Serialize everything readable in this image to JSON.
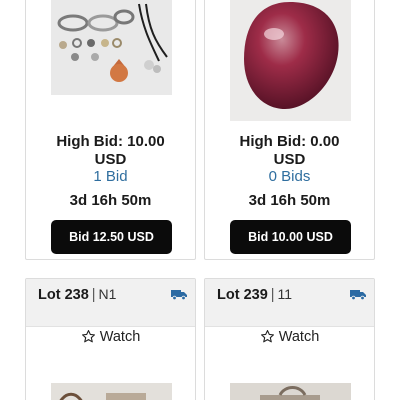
{
  "lots_top": [
    {
      "image_alt": "Jewelry lot with bracelets, rings and necklaces",
      "high_bid": "High Bid: 10.00",
      "currency": "USD",
      "bids": "1 Bid",
      "time_left": "3d 16h 50m",
      "bid_button": "Bid 12.50 USD"
    },
    {
      "image_alt": "Red polished stone",
      "high_bid": "High Bid: 0.00",
      "currency": "USD",
      "bids": "0 Bids",
      "time_left": "3d 16h 50m",
      "bid_button": "Bid 10.00 USD"
    }
  ],
  "lots_bottom": [
    {
      "lot": "Lot 238",
      "location": "N1",
      "watch": "Watch"
    },
    {
      "lot": "Lot 239",
      "location": "11",
      "watch": "Watch"
    }
  ],
  "colors": {
    "accent_link": "#2f6e9f",
    "button_bg": "#0b0b0b",
    "truck_icon": "#2b6aa3"
  },
  "icons": [
    "truck-icon",
    "star-outline-icon"
  ]
}
